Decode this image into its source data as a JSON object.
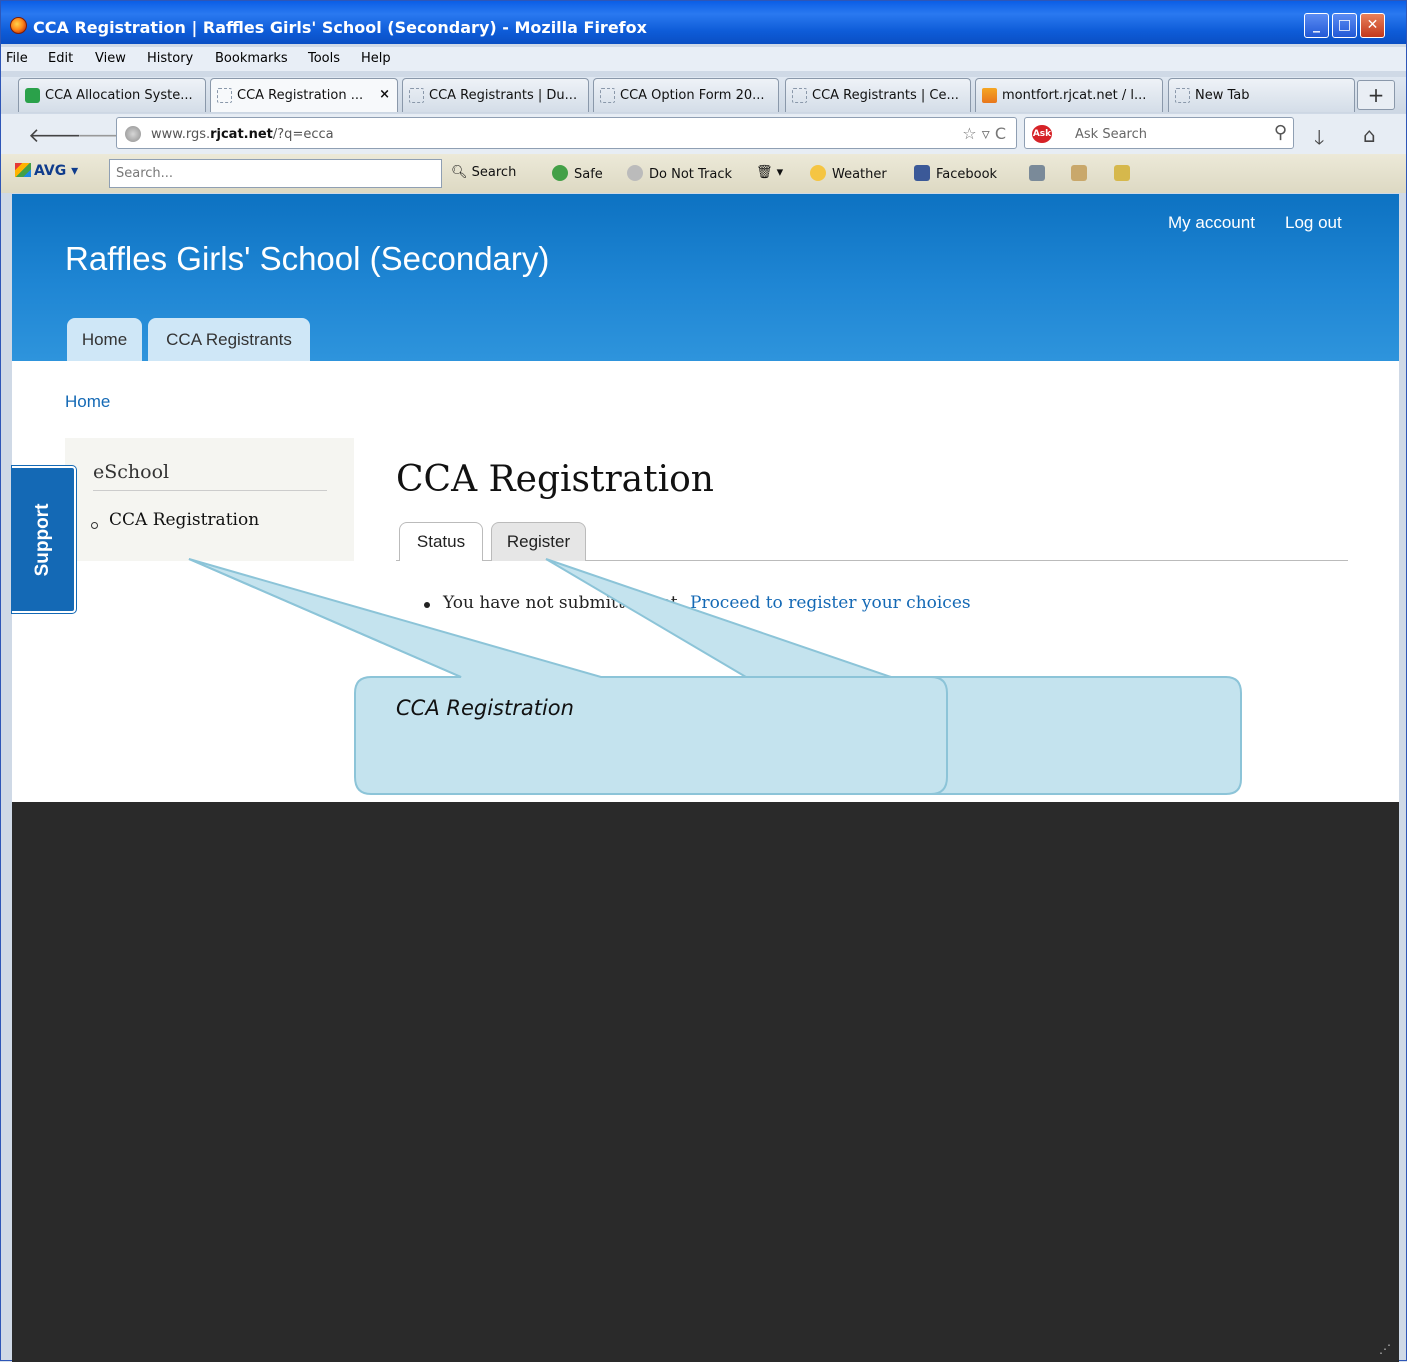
{
  "window": {
    "title": "CCA Registration | Raffles Girls' School (Secondary) - Mozilla Firefox",
    "controls": [
      "minimize",
      "maximize",
      "close"
    ]
  },
  "menu": [
    "File",
    "Edit",
    "View",
    "History",
    "Bookmarks",
    "Tools",
    "Help"
  ],
  "tabs": [
    {
      "label": "CCA Allocation Syste...",
      "icon": "green-app-icon"
    },
    {
      "label": "CCA Registration ...",
      "active": true,
      "close": "×"
    },
    {
      "label": "CCA Registrants | Du..."
    },
    {
      "label": "CCA Option Form 20..."
    },
    {
      "label": "CCA Registrants | Ce..."
    },
    {
      "label": "montfort.rjcat.net / l...",
      "icon": "pma-icon"
    },
    {
      "label": "New Tab"
    }
  ],
  "newtab": "+",
  "nav": {
    "url_host_prefix": "www.rgs.",
    "url_host_main": "rjcat.net",
    "url_path": "/?q=ecca",
    "search_placeholder": "Ask Search",
    "ask_logo": "Ask"
  },
  "avg": {
    "logo": "AVG",
    "search_placeholder": "Search...",
    "search_btn": "Search",
    "safe": "Safe",
    "dnt": "Do Not Track",
    "weather": "Weather",
    "facebook": "Facebook"
  },
  "site": {
    "name": "Raffles Girls' School (Secondary)",
    "my_account": "My account",
    "log_out": "Log out",
    "main_tabs": [
      "Home",
      "CCA Registrants"
    ],
    "breadcrumb": "Home"
  },
  "sidebar": {
    "title": "eSchool",
    "items": [
      "CCA Registration"
    ]
  },
  "main": {
    "title": "CCA Registration",
    "tabs": [
      "Status",
      "Register"
    ],
    "status_text": "You have not submitted yet.",
    "status_link": "Proceed to register your choices"
  },
  "support": "Support",
  "callout": {
    "label": "CCA Registration",
    "fill": "#c4e3ee",
    "stroke": "#8cc4d8"
  }
}
